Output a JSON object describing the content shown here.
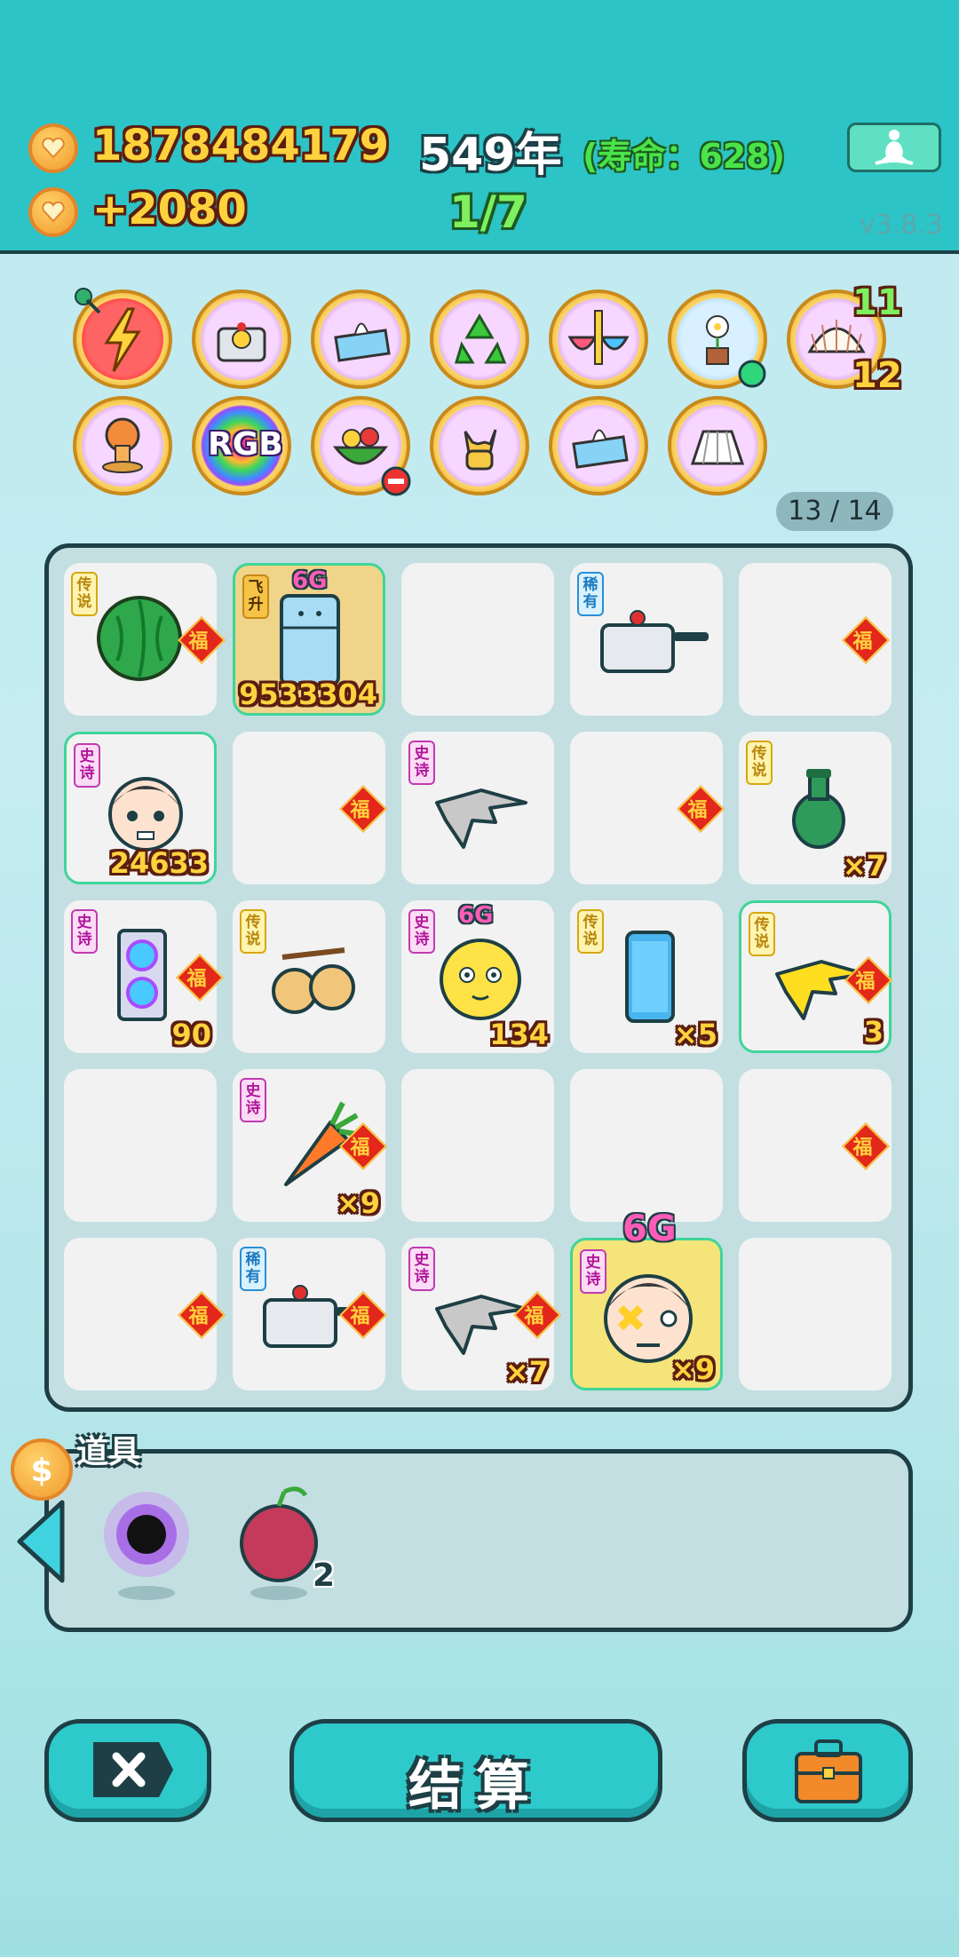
{
  "header": {
    "gold": "1878484179",
    "income": "+2080",
    "year": "549年",
    "lifespan": "(寿命：628)",
    "stage": "1/7",
    "version": "v3.8.3"
  },
  "relics": {
    "row1": [
      {
        "name": "lightning-relic-icon"
      },
      {
        "name": "pot-duck-relic-icon"
      },
      {
        "name": "tissue-box-relic-icon"
      },
      {
        "name": "recycle-relic-icon"
      },
      {
        "name": "bowls-relic-icon"
      },
      {
        "name": "flower-pot-relic-icon"
      },
      {
        "name": "shell-relic-icon",
        "top_count": "11",
        "bottom_count": "12"
      }
    ],
    "row2": [
      {
        "name": "mushroom-cloud-relic-icon"
      },
      {
        "name": "rgb-relic-icon",
        "label": "RGB"
      },
      {
        "name": "fruit-basket-relic-icon"
      },
      {
        "name": "rock-hand-relic-icon"
      },
      {
        "name": "tissue-box-relic-icon"
      },
      {
        "name": "skirt-relic-icon"
      }
    ],
    "page": "13 / 14"
  },
  "board": {
    "cells": [
      {
        "rarity": "传说",
        "item": "watermelon",
        "fu": true
      },
      {
        "rarity": "飞升",
        "item": "fridge",
        "tag": "6G",
        "count": "9533304"
      },
      {},
      {
        "rarity": "稀有",
        "item": "pressure-cooker"
      },
      {
        "fu": true
      },
      {
        "rarity": "史诗",
        "item": "man-face",
        "count": "24633"
      },
      {
        "fu": true
      },
      {
        "rarity": "史诗",
        "item": "pointing-hand-gray"
      },
      {
        "fu": true
      },
      {
        "rarity": "传说",
        "item": "jade-vase",
        "count": "×7"
      },
      {
        "rarity": "史诗",
        "item": "gpu",
        "fu": true,
        "count": "90"
      },
      {
        "rarity": "传说",
        "item": "longan"
      },
      {
        "rarity": "史诗",
        "item": "chick-face",
        "tag": "6G",
        "count": "134"
      },
      {
        "rarity": "传说",
        "item": "phone",
        "count": "×5"
      },
      {
        "rarity": "传说",
        "item": "pointing-hand-yellow",
        "fu": true,
        "count": "3"
      },
      {},
      {
        "rarity": "史诗",
        "item": "carrot",
        "fu": true,
        "count": "×9"
      },
      {},
      {},
      {
        "fu": true
      },
      {
        "fu": true
      },
      {
        "rarity": "稀有",
        "item": "pressure-cooker",
        "fu": true
      },
      {
        "rarity": "史诗",
        "item": "pointing-hand-gray",
        "fu": true,
        "count": "×7"
      },
      {
        "rarity": "史诗",
        "item": "man-face-dizzy",
        "tag": "6G",
        "count": "×9"
      },
      {}
    ],
    "fu_label": "福"
  },
  "tools": {
    "title": "道具",
    "items": [
      {
        "name": "black-hole-icon",
        "count": ""
      },
      {
        "name": "lychee-icon",
        "count": "2"
      }
    ]
  },
  "actions": {
    "settle": "结算"
  },
  "colors": {
    "header_bg": "#2cc4c6",
    "gold_text": "#ffd23d",
    "button_bg": "#2ec9cb"
  }
}
